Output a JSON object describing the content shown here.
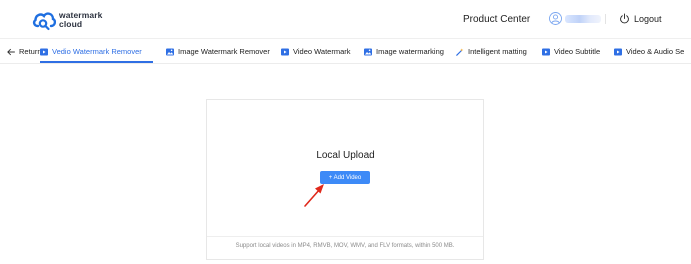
{
  "header": {
    "logo_line1": "watermark",
    "logo_line2": "cloud",
    "product_center": "Product Center",
    "logout_label": "Logout",
    "brand_color": "#2f6fe4"
  },
  "nav": {
    "items": [
      {
        "label": "Return",
        "icon": "arrow-left-icon"
      },
      {
        "label": "Vedio Watermark Remover",
        "icon": "video-icon",
        "active": true
      },
      {
        "label": "Image Watermark Remover",
        "icon": "image-icon"
      },
      {
        "label": "Video Watermark",
        "icon": "video-icon"
      },
      {
        "label": "Image watermarking",
        "icon": "image-icon"
      },
      {
        "label": "Intelligent matting",
        "icon": "magic-wand-icon"
      },
      {
        "label": "Video Subtitle",
        "icon": "video-icon"
      },
      {
        "label": "Video & Audio Se",
        "icon": "video-icon"
      }
    ]
  },
  "upload": {
    "title": "Local Upload",
    "button_label": "+ Add Video",
    "button_color": "#3d8af7",
    "note": "Support local videos in MP4, RMVB, MOV, WMV, and FLV formats,  within 500 MB."
  },
  "annotation": {
    "arrow_color": "#e0291b"
  }
}
